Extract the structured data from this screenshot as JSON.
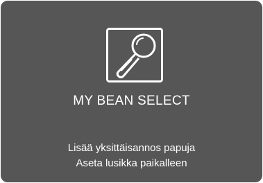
{
  "screen": {
    "title": "MY BEAN SELECT",
    "icon": "spoon-icon",
    "instructions": [
      "Lisää yksittäisannos papuja",
      "Aseta lusikka paikalleen"
    ]
  },
  "colors": {
    "background": "#565656",
    "foreground": "#ffffff"
  }
}
